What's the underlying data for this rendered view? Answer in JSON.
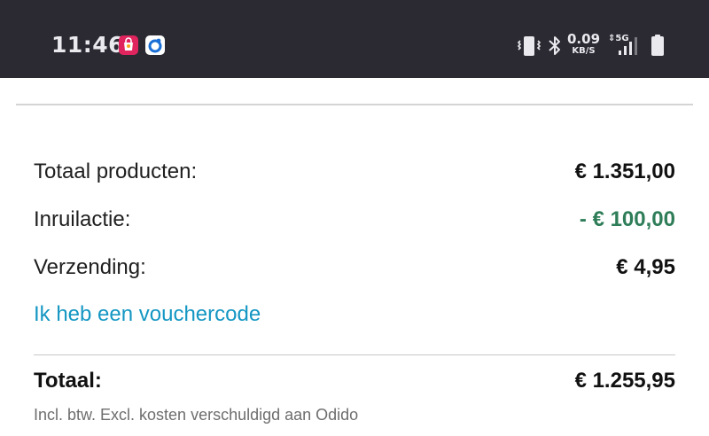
{
  "status_bar": {
    "time": "11:46",
    "net_speed": "0.09",
    "net_speed_unit": "KB/S",
    "network_type": "5G",
    "icons": [
      "shopping-app-icon",
      "odido-app-icon",
      "vibrate-icon",
      "bluetooth-icon",
      "signal-icon",
      "battery-icon"
    ]
  },
  "summary": {
    "rows": [
      {
        "label": "Totaal producten:",
        "value": "€ 1.351,00"
      },
      {
        "label": "Inruilactie:",
        "value": "- € 100,00"
      },
      {
        "label": "Verzending:",
        "value": "€ 4,95"
      }
    ],
    "voucher_link": "Ik heb een vouchercode",
    "total_label": "Totaal:",
    "total_value": "€ 1.255,95",
    "note": "Incl. btw. Excl. kosten verschuldigd aan Odido"
  },
  "colors": {
    "status_bar_bg": "#2b2a33",
    "discount_green": "#2e7d58",
    "link_blue": "#1597c3"
  }
}
